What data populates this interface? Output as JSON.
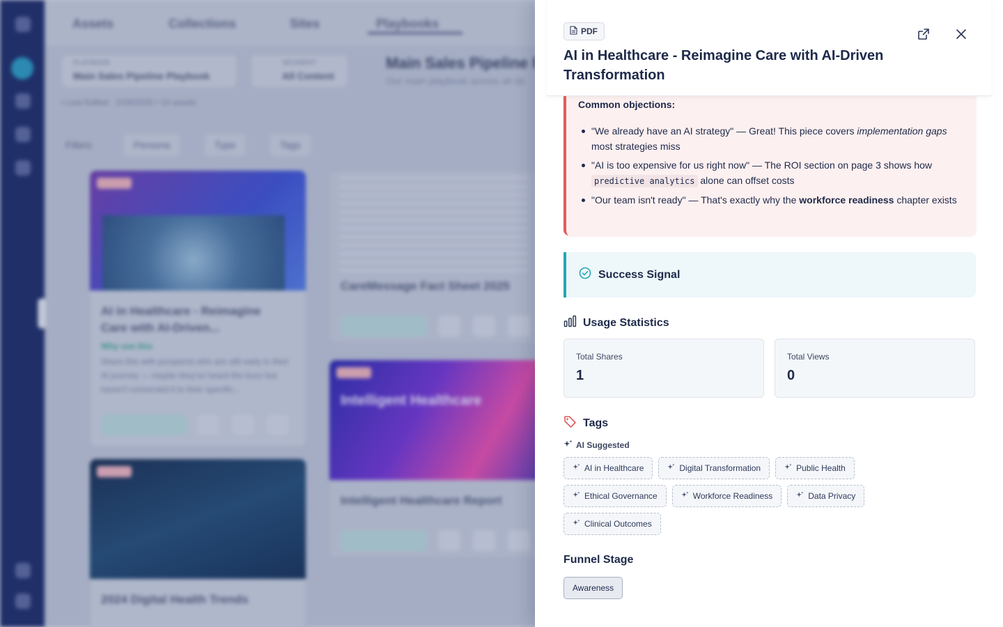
{
  "background": {
    "nav_tabs": [
      "Assets",
      "Collections",
      "Sites",
      "Playbooks"
    ],
    "playbook_selector": {
      "label": "PLAYBOOK",
      "value": "Main Sales Pipeline Playbook"
    },
    "segment_selector": {
      "label": "SEGMENT",
      "value": "All Content"
    },
    "page_title": "Main Sales Pipeline Pl",
    "page_subtitle": "Our main playbook across all de",
    "breadcrumb": "• Last Edited · 2/16/2025  •  13 assets",
    "filters": [
      "Filters",
      "Persona",
      "Type",
      "Tags"
    ],
    "cards": [
      {
        "title": "AI in Healthcare - Reimagine Care with AI-Driven...",
        "why": "Why use this",
        "desc": "Share this with prospects who are still early in their AI journey — maybe they've heard the buzz but haven't connected it to their specific...",
        "share": "Share"
      },
      {
        "title": "CareMessage Fact Sheet 2025",
        "share": "Share"
      },
      {
        "title": "Intelligent Healthcare Report",
        "thumb_text": "Intelligent Healthcare",
        "share": "Share"
      },
      {
        "title": "2024 Digital Health Trends"
      }
    ]
  },
  "drawer": {
    "type_badge": "PDF",
    "title": "AI in Healthcare - Reimagine Care with AI-Driven Transformation",
    "objections": {
      "heading": "Common objections:",
      "items": [
        {
          "a": "\"We already have an AI strategy\" — Great! This piece covers ",
          "em": "implementation gaps",
          "b": " most strategies miss"
        },
        {
          "a": "\"AI is too expensive for us right now\" — The ROI section on page 3 shows how ",
          "code": "predictive analytics",
          "b": " alone can offset costs"
        },
        {
          "a": "\"Our team isn't ready\" — That's exactly why the ",
          "strong": "workforce readiness",
          "b": " chapter exists"
        }
      ]
    },
    "success_signal": "Success Signal",
    "usage": {
      "heading": "Usage Statistics",
      "total_shares_label": "Total Shares",
      "total_shares": "1",
      "total_views_label": "Total Views",
      "total_views": "0"
    },
    "tags": {
      "heading": "Tags",
      "ai_suggested_label": "AI Suggested",
      "items": [
        "AI in Healthcare",
        "Digital Transformation",
        "Public Health",
        "Ethical Governance",
        "Workforce Readiness",
        "Data Privacy",
        "Clinical Outcomes"
      ]
    },
    "funnel": {
      "heading": "Funnel Stage",
      "stage": "Awareness"
    }
  },
  "colors": {
    "sidebar": "#1e2d68",
    "objection_accent": "#e05d5d",
    "success_accent": "#22a8b3",
    "tag_icon": "#e05d5d",
    "text_primary": "#1e2a4a"
  },
  "icons": [
    "file-icon",
    "external-link-icon",
    "close-icon",
    "check-circle-icon",
    "bar-chart-icon",
    "tag-icon",
    "sparkle-icon"
  ]
}
